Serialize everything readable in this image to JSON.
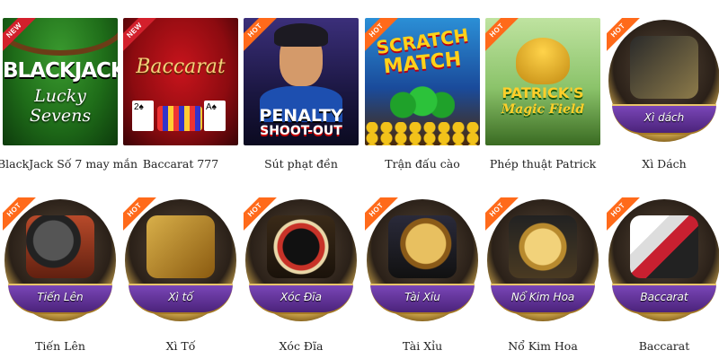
{
  "games": [
    {
      "title": "BlackJack Số 7 may mắn",
      "badge": "NEW",
      "art_line1": "BLACKJACK",
      "art_line2": "Lucky Sevens"
    },
    {
      "title": "Baccarat 777",
      "badge": "NEW",
      "art_line1": "Baccarat"
    },
    {
      "title": "Sút phạt đền",
      "badge": "HOT",
      "art_line1": "PENALTY",
      "art_line2": "SHOOT-OUT"
    },
    {
      "title": "Trận đấu cào",
      "badge": "HOT",
      "art_line1": "SCRATCH",
      "art_line2": "MATCH"
    },
    {
      "title": "Phép thuật Patrick",
      "badge": "HOT",
      "art_line1": "PATRICK'S",
      "art_line2": "Magic Field"
    },
    {
      "title": "Xì Dách",
      "badge": "HOT",
      "art_band": "Xì dách"
    },
    {
      "title": "Tiến Lên",
      "badge": "HOT",
      "art_band": "Tiến Lên"
    },
    {
      "title": "Xì Tố",
      "badge": "HOT",
      "art_band": "Xì tố"
    },
    {
      "title": "Xóc Đĩa",
      "badge": "HOT",
      "art_band": "Xóc Đĩa"
    },
    {
      "title": "Tài Xỉu",
      "badge": "HOT",
      "art_band": "Tài Xỉu"
    },
    {
      "title": "Nổ Kim Hoa",
      "badge": "HOT",
      "art_band": "Nổ Kim Hoa"
    },
    {
      "title": "Baccarat",
      "badge": "HOT",
      "art_band": "Baccarat"
    }
  ],
  "colors": {
    "badge_new": "#d3202c",
    "badge_hot": "#ff6a1a",
    "band_purple": "#6a3aa8"
  }
}
